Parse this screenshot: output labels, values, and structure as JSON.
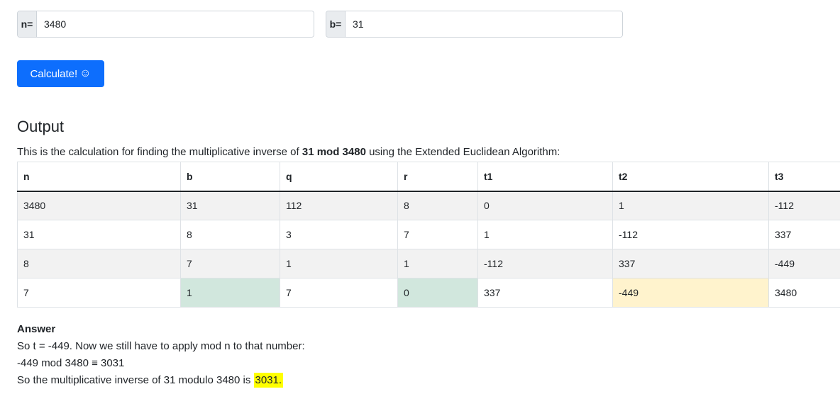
{
  "inputs": {
    "n": {
      "label": "n=",
      "value": "3480"
    },
    "b": {
      "label": "b=",
      "value": "31"
    }
  },
  "calculate_button": {
    "label": "Calculate!",
    "icon": "smile-icon"
  },
  "output": {
    "heading": "Output",
    "desc_prefix": "This is the calculation for finding the multiplicative inverse of ",
    "desc_bold": "31 mod 3480",
    "desc_suffix": " using the Extended Euclidean Algorithm:"
  },
  "table": {
    "headers": [
      "n",
      "b",
      "q",
      "r",
      "t1",
      "t2",
      "t3"
    ],
    "rows": [
      [
        "3480",
        "31",
        "112",
        "8",
        "0",
        "1",
        "-112"
      ],
      [
        "31",
        "8",
        "3",
        "7",
        "1",
        "-112",
        "337"
      ],
      [
        "8",
        "7",
        "1",
        "1",
        "-112",
        "337",
        "-449"
      ],
      [
        "7",
        "1",
        "7",
        "0",
        "337",
        "-449",
        "3480"
      ]
    ]
  },
  "answer": {
    "label": "Answer",
    "line1": "So t = -449. Now we still have to apply mod n to that number:",
    "line2": "-449 mod 3480 ≡ 3031",
    "line3_prefix": "So the multiplicative inverse of 31 modulo 3480 is ",
    "line3_value": "3031."
  },
  "colors": {
    "primary": "#0d6efd",
    "highlight_green": "#d1e7dd",
    "highlight_yellow": "#fff3cd",
    "answer_mark": "#ffff00"
  }
}
